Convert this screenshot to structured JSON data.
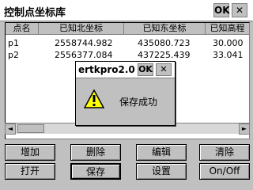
{
  "window": {
    "title": "控制点坐标库",
    "ok_label": "OK",
    "close_glyph": "✕"
  },
  "table": {
    "columns": [
      "点名",
      "已知北坐标",
      "已知东坐标",
      "已知高程"
    ],
    "rows": [
      [
        "p1",
        "2558744.982",
        "435080.723",
        "30.000"
      ],
      [
        "p2",
        "2556377.084",
        "437225.439",
        "33.041"
      ]
    ]
  },
  "scrollbar": {
    "left_arrow": "◄",
    "right_arrow": "►"
  },
  "buttons": {
    "add": "增加",
    "delete": "删除",
    "edit": "编辑",
    "clear": "清除",
    "open": "打开",
    "save": "保存",
    "settings": "设置",
    "onoff": "On/Off"
  },
  "dialog": {
    "title": "ertkpro2.0",
    "ok_label": "OK",
    "close_glyph": "✕",
    "message": "保存成功",
    "icon": "warning-icon"
  }
}
